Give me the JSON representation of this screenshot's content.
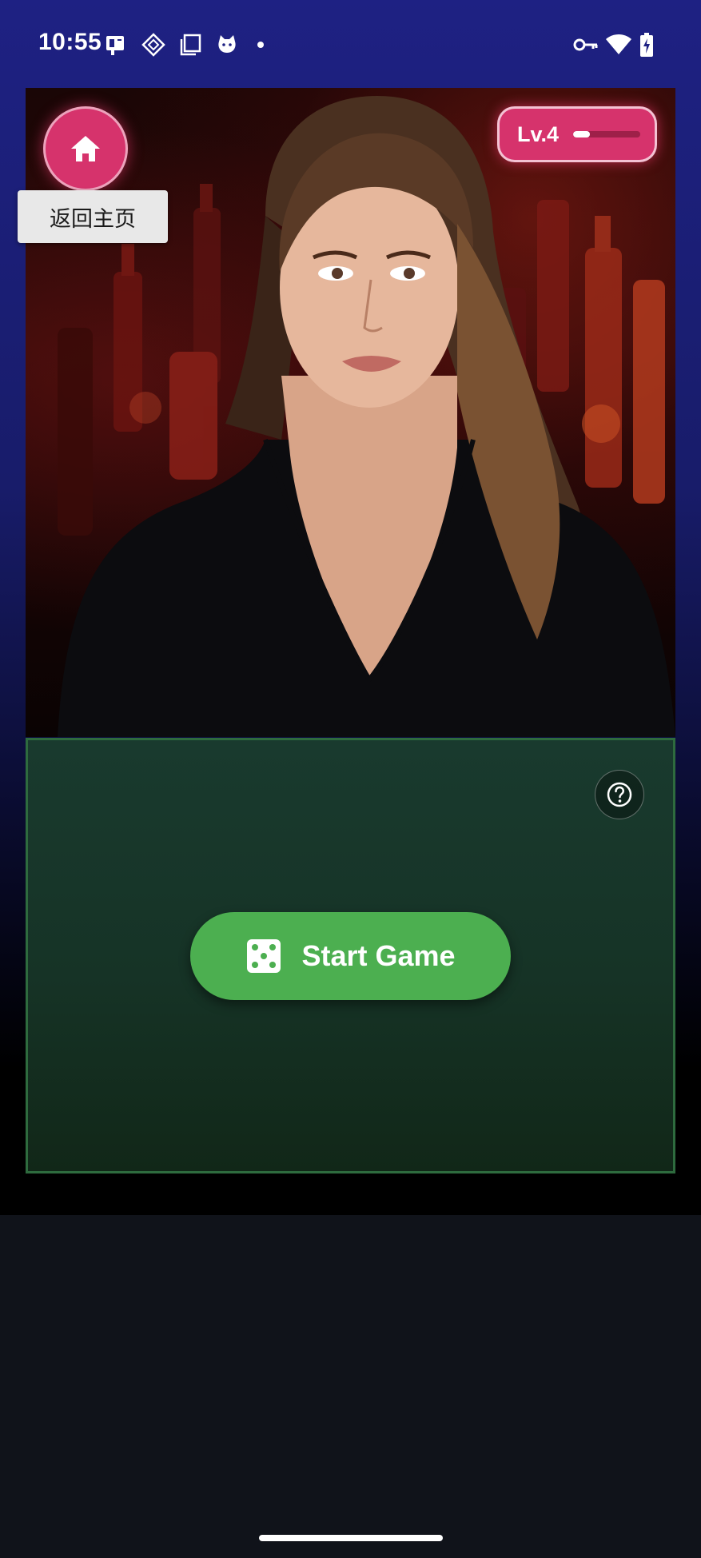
{
  "status_bar": {
    "time": "10:55",
    "left_icons": [
      "id-card-icon",
      "diamond-icon",
      "copy-icon",
      "cat-icon",
      "dot-icon"
    ],
    "right_icons": [
      "vpn-key-icon",
      "wifi-icon",
      "battery-charging-icon"
    ]
  },
  "character": {
    "image": "woman-portrait-bar-background"
  },
  "home": {
    "icon": "home-icon",
    "tooltip": "返回主页"
  },
  "level": {
    "label": "Lv.4",
    "progress": 0.25
  },
  "game": {
    "help_icon": "help-icon",
    "start_icon": "dice-icon",
    "start_label": "Start Game"
  },
  "colors": {
    "accent_pink": "#d6336c",
    "start_green": "#4caf50",
    "panel_green": "#193a2e",
    "panel_border": "#2e6b3e"
  }
}
